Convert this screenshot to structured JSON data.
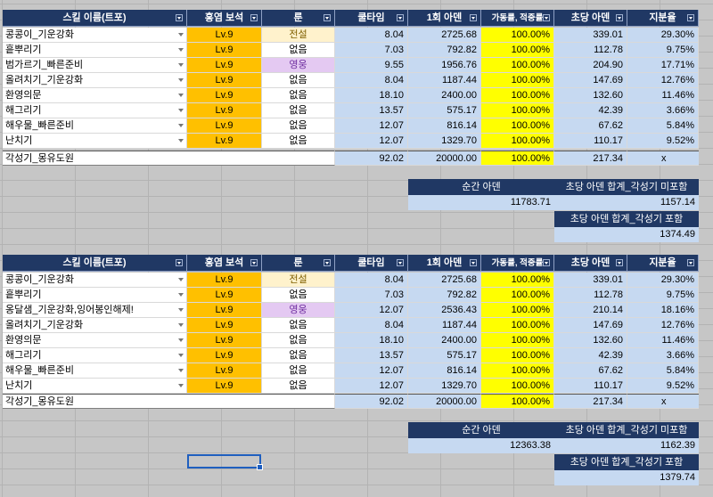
{
  "headers": {
    "skill": "스킬 이름(트포)",
    "gem": "홍염 보석",
    "rune": "룬",
    "cooldown": "쿨타임",
    "hit": "1회 아덴",
    "rate": "가동률, 적중률",
    "dps": "초당 아덴",
    "share": "지분율"
  },
  "table1": {
    "rows": [
      {
        "name": "콩콩이_기운강화",
        "gem": "Lv.9",
        "rune": "전설",
        "rune_type": "legend",
        "cool": "8.04",
        "hit": "2725.68",
        "rate": "100.00%",
        "dps": "339.01",
        "share": "29.30%"
      },
      {
        "name": "흩뿌리기",
        "gem": "Lv.9",
        "rune": "없음",
        "rune_type": "none",
        "cool": "7.03",
        "hit": "792.82",
        "rate": "100.00%",
        "dps": "112.78",
        "share": "9.75%"
      },
      {
        "name": "범가르기_빠른준비",
        "gem": "Lv.9",
        "rune": "영웅",
        "rune_type": "hero",
        "cool": "9.55",
        "hit": "1956.76",
        "rate": "100.00%",
        "dps": "204.90",
        "share": "17.71%"
      },
      {
        "name": "올려치기_기운강화",
        "gem": "Lv.9",
        "rune": "없음",
        "rune_type": "none",
        "cool": "8.04",
        "hit": "1187.44",
        "rate": "100.00%",
        "dps": "147.69",
        "share": "12.76%"
      },
      {
        "name": "환영의문",
        "gem": "Lv.9",
        "rune": "없음",
        "rune_type": "none",
        "cool": "18.10",
        "hit": "2400.00",
        "rate": "100.00%",
        "dps": "132.60",
        "share": "11.46%"
      },
      {
        "name": "해그리기",
        "gem": "Lv.9",
        "rune": "없음",
        "rune_type": "none",
        "cool": "13.57",
        "hit": "575.17",
        "rate": "100.00%",
        "dps": "42.39",
        "share": "3.66%"
      },
      {
        "name": "해우물_빠른준비",
        "gem": "Lv.9",
        "rune": "없음",
        "rune_type": "none",
        "cool": "12.07",
        "hit": "816.14",
        "rate": "100.00%",
        "dps": "67.62",
        "share": "5.84%"
      },
      {
        "name": "난치기",
        "gem": "Lv.9",
        "rune": "없음",
        "rune_type": "none",
        "cool": "12.07",
        "hit": "1329.70",
        "rate": "100.00%",
        "dps": "110.17",
        "share": "9.52%"
      }
    ],
    "summary": {
      "name": "각성기_몽유도원",
      "cool": "92.02",
      "hit": "20000.00",
      "rate": "100.00%",
      "dps": "217.34",
      "share": "x"
    },
    "instant_label": "순간 아덴",
    "instant_value": "11783.71",
    "dps_excl_label": "초당 아덴 합계_각성기 미포함",
    "dps_excl_value": "1157.14",
    "dps_incl_label": "초당 아덴 합계_각성기 포함",
    "dps_incl_value": "1374.49"
  },
  "table2": {
    "rows": [
      {
        "name": "콩콩이_기운강화",
        "gem": "Lv.9",
        "rune": "전설",
        "rune_type": "legend",
        "cool": "8.04",
        "hit": "2725.68",
        "rate": "100.00%",
        "dps": "339.01",
        "share": "29.30%"
      },
      {
        "name": "흩뿌리기",
        "gem": "Lv.9",
        "rune": "없음",
        "rune_type": "none",
        "cool": "7.03",
        "hit": "792.82",
        "rate": "100.00%",
        "dps": "112.78",
        "share": "9.75%"
      },
      {
        "name": "옹달샘_기운강화,잉어봉인해제!",
        "gem": "Lv.9",
        "rune": "영웅",
        "rune_type": "hero",
        "cool": "12.07",
        "hit": "2536.43",
        "rate": "100.00%",
        "dps": "210.14",
        "share": "18.16%"
      },
      {
        "name": "올려치기_기운강화",
        "gem": "Lv.9",
        "rune": "없음",
        "rune_type": "none",
        "cool": "8.04",
        "hit": "1187.44",
        "rate": "100.00%",
        "dps": "147.69",
        "share": "12.76%"
      },
      {
        "name": "환영의문",
        "gem": "Lv.9",
        "rune": "없음",
        "rune_type": "none",
        "cool": "18.10",
        "hit": "2400.00",
        "rate": "100.00%",
        "dps": "132.60",
        "share": "11.46%"
      },
      {
        "name": "해그리기",
        "gem": "Lv.9",
        "rune": "없음",
        "rune_type": "none",
        "cool": "13.57",
        "hit": "575.17",
        "rate": "100.00%",
        "dps": "42.39",
        "share": "3.66%"
      },
      {
        "name": "해우물_빠른준비",
        "gem": "Lv.9",
        "rune": "없음",
        "rune_type": "none",
        "cool": "12.07",
        "hit": "816.14",
        "rate": "100.00%",
        "dps": "67.62",
        "share": "5.84%"
      },
      {
        "name": "난치기",
        "gem": "Lv.9",
        "rune": "없음",
        "rune_type": "none",
        "cool": "12.07",
        "hit": "1329.70",
        "rate": "100.00%",
        "dps": "110.17",
        "share": "9.52%"
      }
    ],
    "summary": {
      "name": "각성기_몽유도원",
      "cool": "92.02",
      "hit": "20000.00",
      "rate": "100.00%",
      "dps": "217.34",
      "share": "x"
    },
    "instant_label": "순간 아덴",
    "instant_value": "12363.38",
    "dps_excl_label": "초당 아덴 합계_각성기 미포함",
    "dps_excl_value": "1162.39",
    "dps_incl_label": "초당 아덴 합계_각성기 포함",
    "dps_incl_value": "1379.74"
  }
}
